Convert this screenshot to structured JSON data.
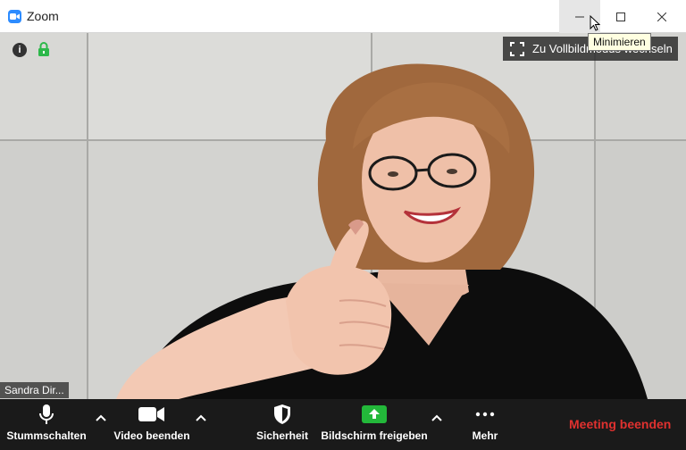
{
  "window": {
    "title": "Zoom",
    "tooltip": "Minimieren"
  },
  "video": {
    "fullscreen_label": "Zu Vollbildmodus wechseln",
    "participant_name": "Sandra Dir...",
    "info_symbol": "i"
  },
  "toolbar": {
    "mute_label": "Stummschalten",
    "video_label": "Video beenden",
    "security_label": "Sicherheit",
    "share_label": "Bildschirm freigeben",
    "more_label": "Mehr",
    "end_label": "Meeting beenden"
  },
  "colors": {
    "accent": "#2d8cff",
    "share_green": "#23b83a",
    "end_red": "#e0312f",
    "lock_green": "#2db84a"
  },
  "icons": [
    "zoom-logo-icon",
    "minimize-icon",
    "maximize-icon",
    "close-icon",
    "info-icon",
    "lock-icon",
    "fullscreen-icon",
    "microphone-icon",
    "camera-icon",
    "shield-icon",
    "share-arrow-icon",
    "more-dots-icon",
    "chevron-up-icon"
  ]
}
